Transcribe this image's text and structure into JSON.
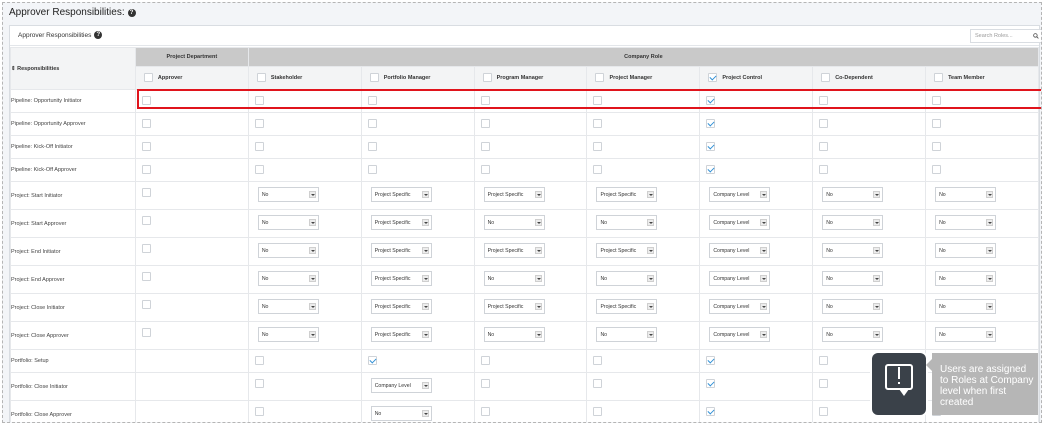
{
  "outer_title": "Approver Responsibilities:",
  "panel": {
    "title": "Approver Responsibilities",
    "search_placeholder": "Search Roles..."
  },
  "groups": {
    "project_department": "Project Department",
    "company_role": "Company Role"
  },
  "responsibilities_header": "Responsibilities",
  "sort_icon": "⇕",
  "columns": [
    {
      "label": "Approver",
      "checked": false
    },
    {
      "label": "Stakeholder",
      "checked": false
    },
    {
      "label": "Portfolio Manager",
      "checked": false
    },
    {
      "label": "Program Manager",
      "checked": false
    },
    {
      "label": "Project Manager",
      "checked": false
    },
    {
      "label": "Project Control",
      "checked": true
    },
    {
      "label": "Co-Dependent",
      "checked": false
    },
    {
      "label": "Team Member",
      "checked": false
    }
  ],
  "rows": [
    {
      "name": "Pipeline: Opportunity Initiator",
      "cells": [
        {
          "t": "cb",
          "v": false
        },
        {
          "t": "cb",
          "v": false
        },
        {
          "t": "cb",
          "v": false
        },
        {
          "t": "cb",
          "v": false
        },
        {
          "t": "cb",
          "v": false
        },
        {
          "t": "cb",
          "v": true
        },
        {
          "t": "cb",
          "v": false
        },
        {
          "t": "cb",
          "v": false
        }
      ]
    },
    {
      "name": "Pipeline: Opportunity Approver",
      "cells": [
        {
          "t": "cb",
          "v": false
        },
        {
          "t": "cb",
          "v": false
        },
        {
          "t": "cb",
          "v": false
        },
        {
          "t": "cb",
          "v": false
        },
        {
          "t": "cb",
          "v": false
        },
        {
          "t": "cb",
          "v": true
        },
        {
          "t": "cb",
          "v": false
        },
        {
          "t": "cb",
          "v": false
        }
      ]
    },
    {
      "name": "Pipeline: Kick-Off Initiator",
      "cells": [
        {
          "t": "cb",
          "v": false
        },
        {
          "t": "cb",
          "v": false
        },
        {
          "t": "cb",
          "v": false
        },
        {
          "t": "cb",
          "v": false
        },
        {
          "t": "cb",
          "v": false
        },
        {
          "t": "cb",
          "v": true
        },
        {
          "t": "cb",
          "v": false
        },
        {
          "t": "cb",
          "v": false
        }
      ]
    },
    {
      "name": "Pipeline: Kick-Off Approver",
      "cells": [
        {
          "t": "cb",
          "v": false
        },
        {
          "t": "cb",
          "v": false
        },
        {
          "t": "cb",
          "v": false
        },
        {
          "t": "cb",
          "v": false
        },
        {
          "t": "cb",
          "v": false
        },
        {
          "t": "cb",
          "v": true
        },
        {
          "t": "cb",
          "v": false
        },
        {
          "t": "cb",
          "v": false
        }
      ]
    },
    {
      "name": "Project: Start Initiator",
      "cells": [
        {
          "t": "cb",
          "v": false
        },
        {
          "t": "dd",
          "v": "No"
        },
        {
          "t": "dd",
          "v": "Project Specific"
        },
        {
          "t": "dd",
          "v": "Project Specific"
        },
        {
          "t": "dd",
          "v": "Project Specific"
        },
        {
          "t": "dd",
          "v": "Company Level"
        },
        {
          "t": "dd",
          "v": "No"
        },
        {
          "t": "dd",
          "v": "No"
        }
      ]
    },
    {
      "name": "Project: Start Approver",
      "cells": [
        {
          "t": "cb",
          "v": false
        },
        {
          "t": "dd",
          "v": "No"
        },
        {
          "t": "dd",
          "v": "Project Specific"
        },
        {
          "t": "dd",
          "v": "No"
        },
        {
          "t": "dd",
          "v": "No"
        },
        {
          "t": "dd",
          "v": "Company Level"
        },
        {
          "t": "dd",
          "v": "No"
        },
        {
          "t": "dd",
          "v": "No"
        }
      ]
    },
    {
      "name": "Project: End Initiator",
      "cells": [
        {
          "t": "cb",
          "v": false
        },
        {
          "t": "dd",
          "v": "No"
        },
        {
          "t": "dd",
          "v": "Project Specific"
        },
        {
          "t": "dd",
          "v": "Project Specific"
        },
        {
          "t": "dd",
          "v": "Project Specific"
        },
        {
          "t": "dd",
          "v": "Company Level"
        },
        {
          "t": "dd",
          "v": "No"
        },
        {
          "t": "dd",
          "v": "No"
        }
      ]
    },
    {
      "name": "Project: End Approver",
      "cells": [
        {
          "t": "cb",
          "v": false
        },
        {
          "t": "dd",
          "v": "No"
        },
        {
          "t": "dd",
          "v": "Project Specific"
        },
        {
          "t": "dd",
          "v": "No"
        },
        {
          "t": "dd",
          "v": "No"
        },
        {
          "t": "dd",
          "v": "Company Level"
        },
        {
          "t": "dd",
          "v": "No"
        },
        {
          "t": "dd",
          "v": "No"
        }
      ]
    },
    {
      "name": "Project: Close Initiator",
      "cells": [
        {
          "t": "cb",
          "v": false
        },
        {
          "t": "dd",
          "v": "No"
        },
        {
          "t": "dd",
          "v": "Project Specific"
        },
        {
          "t": "dd",
          "v": "Project Specific"
        },
        {
          "t": "dd",
          "v": "Project Specific"
        },
        {
          "t": "dd",
          "v": "Company Level"
        },
        {
          "t": "dd",
          "v": "No"
        },
        {
          "t": "dd",
          "v": "No"
        }
      ]
    },
    {
      "name": "Project: Close Approver",
      "cells": [
        {
          "t": "cb",
          "v": false
        },
        {
          "t": "dd",
          "v": "No"
        },
        {
          "t": "dd",
          "v": "Project Specific"
        },
        {
          "t": "dd",
          "v": "No"
        },
        {
          "t": "dd",
          "v": "No"
        },
        {
          "t": "dd",
          "v": "Company Level"
        },
        {
          "t": "dd",
          "v": "No"
        },
        {
          "t": "dd",
          "v": "No"
        }
      ]
    },
    {
      "name": "Portfolio: Setup",
      "cells": [
        {
          "t": "none"
        },
        {
          "t": "cb",
          "v": false
        },
        {
          "t": "cb",
          "v": true
        },
        {
          "t": "cb",
          "v": false
        },
        {
          "t": "cb",
          "v": false
        },
        {
          "t": "cb",
          "v": true
        },
        {
          "t": "cb",
          "v": false
        },
        {
          "t": "cb",
          "v": false
        }
      ]
    },
    {
      "name": "Portfolio: Close Initiator",
      "cells": [
        {
          "t": "none"
        },
        {
          "t": "cb",
          "v": false
        },
        {
          "t": "dd",
          "v": "Company Level"
        },
        {
          "t": "cb",
          "v": false
        },
        {
          "t": "cb",
          "v": false
        },
        {
          "t": "cb",
          "v": true
        },
        {
          "t": "cb",
          "v": false
        },
        {
          "t": "cb",
          "v": false
        }
      ]
    },
    {
      "name": "Portfolio: Close Approver",
      "cells": [
        {
          "t": "none"
        },
        {
          "t": "cb",
          "v": false
        },
        {
          "t": "dd",
          "v": "No"
        },
        {
          "t": "cb",
          "v": false
        },
        {
          "t": "cb",
          "v": false
        },
        {
          "t": "cb",
          "v": true
        },
        {
          "t": "cb",
          "v": false
        },
        {
          "t": "cb",
          "v": false
        }
      ]
    }
  ],
  "tooltip": {
    "icon": "alert-bubble-icon",
    "text": "Users are assigned to Roles at Company level when first created"
  },
  "colors": {
    "highlight": "#e0141c",
    "check": "#2f8fd6",
    "group_header": "#c9c9c9",
    "tooltip_bg": "#b6b6b6",
    "tooltip_icon_bg": "#3a4149"
  }
}
